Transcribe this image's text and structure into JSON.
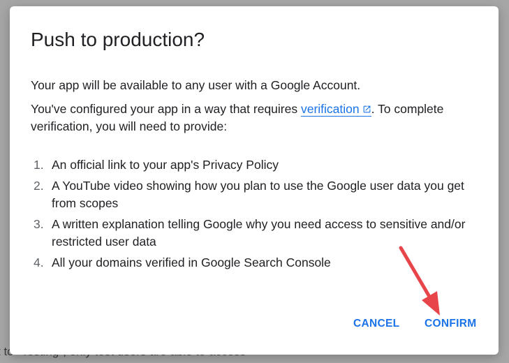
{
  "background": {
    "partial_text": "t to \"Testing\", only test users are able to access"
  },
  "dialog": {
    "title": "Push to production?",
    "para1": "Your app will be available to any user with a Google Account.",
    "para2_before": "You've configured your app in a way that requires ",
    "para2_link": "verification",
    "para2_after": ". To complete verification, you will need to provide:",
    "list_items": [
      {
        "number": "1.",
        "text": "An official link to your app's Privacy Policy"
      },
      {
        "number": "2.",
        "text": "A YouTube video showing how you plan to use the Google user data you get from scopes"
      },
      {
        "number": "3.",
        "text": "A written explanation telling Google why you need access to sensitive and/or restricted user data"
      },
      {
        "number": "4.",
        "text": "All your domains verified in Google Search Console"
      }
    ],
    "cancel_label": "CANCEL",
    "confirm_label": "CONFIRM"
  },
  "annotation": {
    "arrow_color": "#e8454a",
    "arrow_icon": "annotation-arrow"
  },
  "colors": {
    "accent": "#1a73e8",
    "backdrop": "#a6a6a6"
  }
}
